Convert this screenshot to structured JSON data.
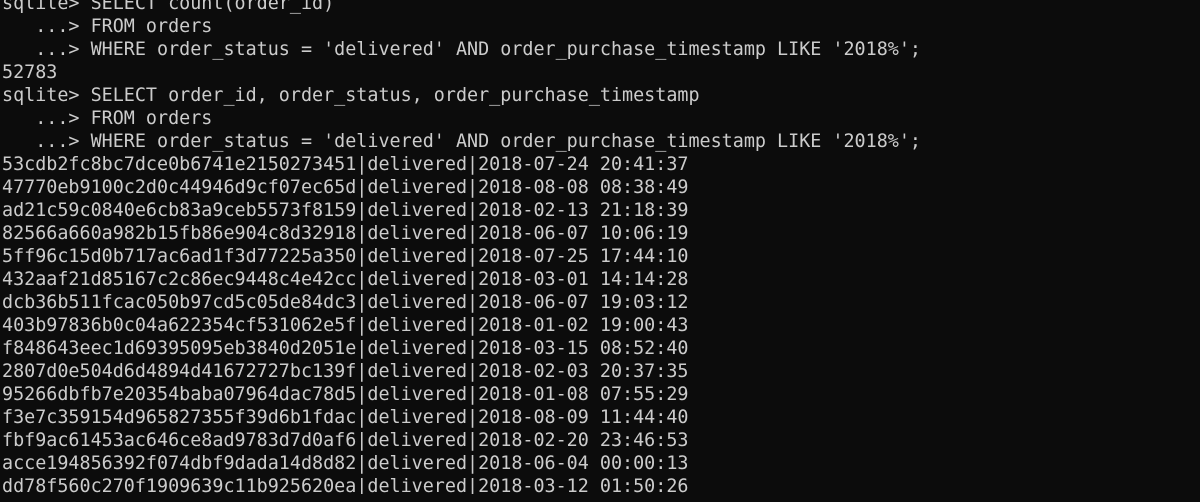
{
  "terminal": {
    "lines": [
      "sqlite> SELECT count(order_id)",
      "   ...> FROM orders",
      "   ...> WHERE order_status = 'delivered' AND order_purchase_timestamp LIKE '2018%';",
      "52783",
      "sqlite> SELECT order_id, order_status, order_purchase_timestamp",
      "   ...> FROM orders",
      "   ...> WHERE order_status = 'delivered' AND order_purchase_timestamp LIKE '2018%';",
      "53cdb2fc8bc7dce0b6741e2150273451|delivered|2018-07-24 20:41:37",
      "47770eb9100c2d0c44946d9cf07ec65d|delivered|2018-08-08 08:38:49",
      "ad21c59c0840e6cb83a9ceb5573f8159|delivered|2018-02-13 21:18:39",
      "82566a660a982b15fb86e904c8d32918|delivered|2018-06-07 10:06:19",
      "5ff96c15d0b717ac6ad1f3d77225a350|delivered|2018-07-25 17:44:10",
      "432aaf21d85167c2c86ec9448c4e42cc|delivered|2018-03-01 14:14:28",
      "dcb36b511fcac050b97cd5c05de84dc3|delivered|2018-06-07 19:03:12",
      "403b97836b0c04a622354cf531062e5f|delivered|2018-01-02 19:00:43",
      "f848643eec1d69395095eb3840d2051e|delivered|2018-03-15 08:52:40",
      "2807d0e504d6d4894d41672727bc139f|delivered|2018-02-03 20:37:35",
      "95266dbfb7e20354baba07964dac78d5|delivered|2018-01-08 07:55:29",
      "f3e7c359154d965827355f39d6b1fdac|delivered|2018-08-09 11:44:40",
      "fbf9ac61453ac646ce8ad9783d7d0af6|delivered|2018-02-20 23:46:53",
      "acce194856392f074dbf9dada14d8d82|delivered|2018-06-04 00:00:13",
      "dd78f560c270f1909639c11b925620ea|delivered|2018-03-12 01:50:26"
    ]
  }
}
